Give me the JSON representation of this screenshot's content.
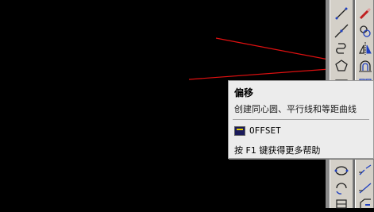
{
  "tooltip": {
    "title": "偏移",
    "description": "创建同心圆、平行线和等距曲线",
    "command": "OFFSET",
    "help": "按 F1 键获得更多帮助"
  },
  "colors": {
    "canvas": "#000000",
    "toolbar": "#d4d0c8",
    "tooltip_bg": "#ececec",
    "annotation_arrow": "#e01010"
  },
  "toolbar_left": {
    "icons": [
      "line-icon",
      "construction-line-icon",
      "polyline-icon",
      "polygon-icon",
      "rectangle-icon",
      "arc-icon",
      "circle-icon",
      "revision-cloud-icon"
    ]
  },
  "toolbar_right": {
    "icons": [
      "erase-icon",
      "copy-icon",
      "mirror-icon",
      "offset-icon",
      "array-icon",
      "break-icon",
      "join-icon",
      "chamfer-icon"
    ]
  }
}
